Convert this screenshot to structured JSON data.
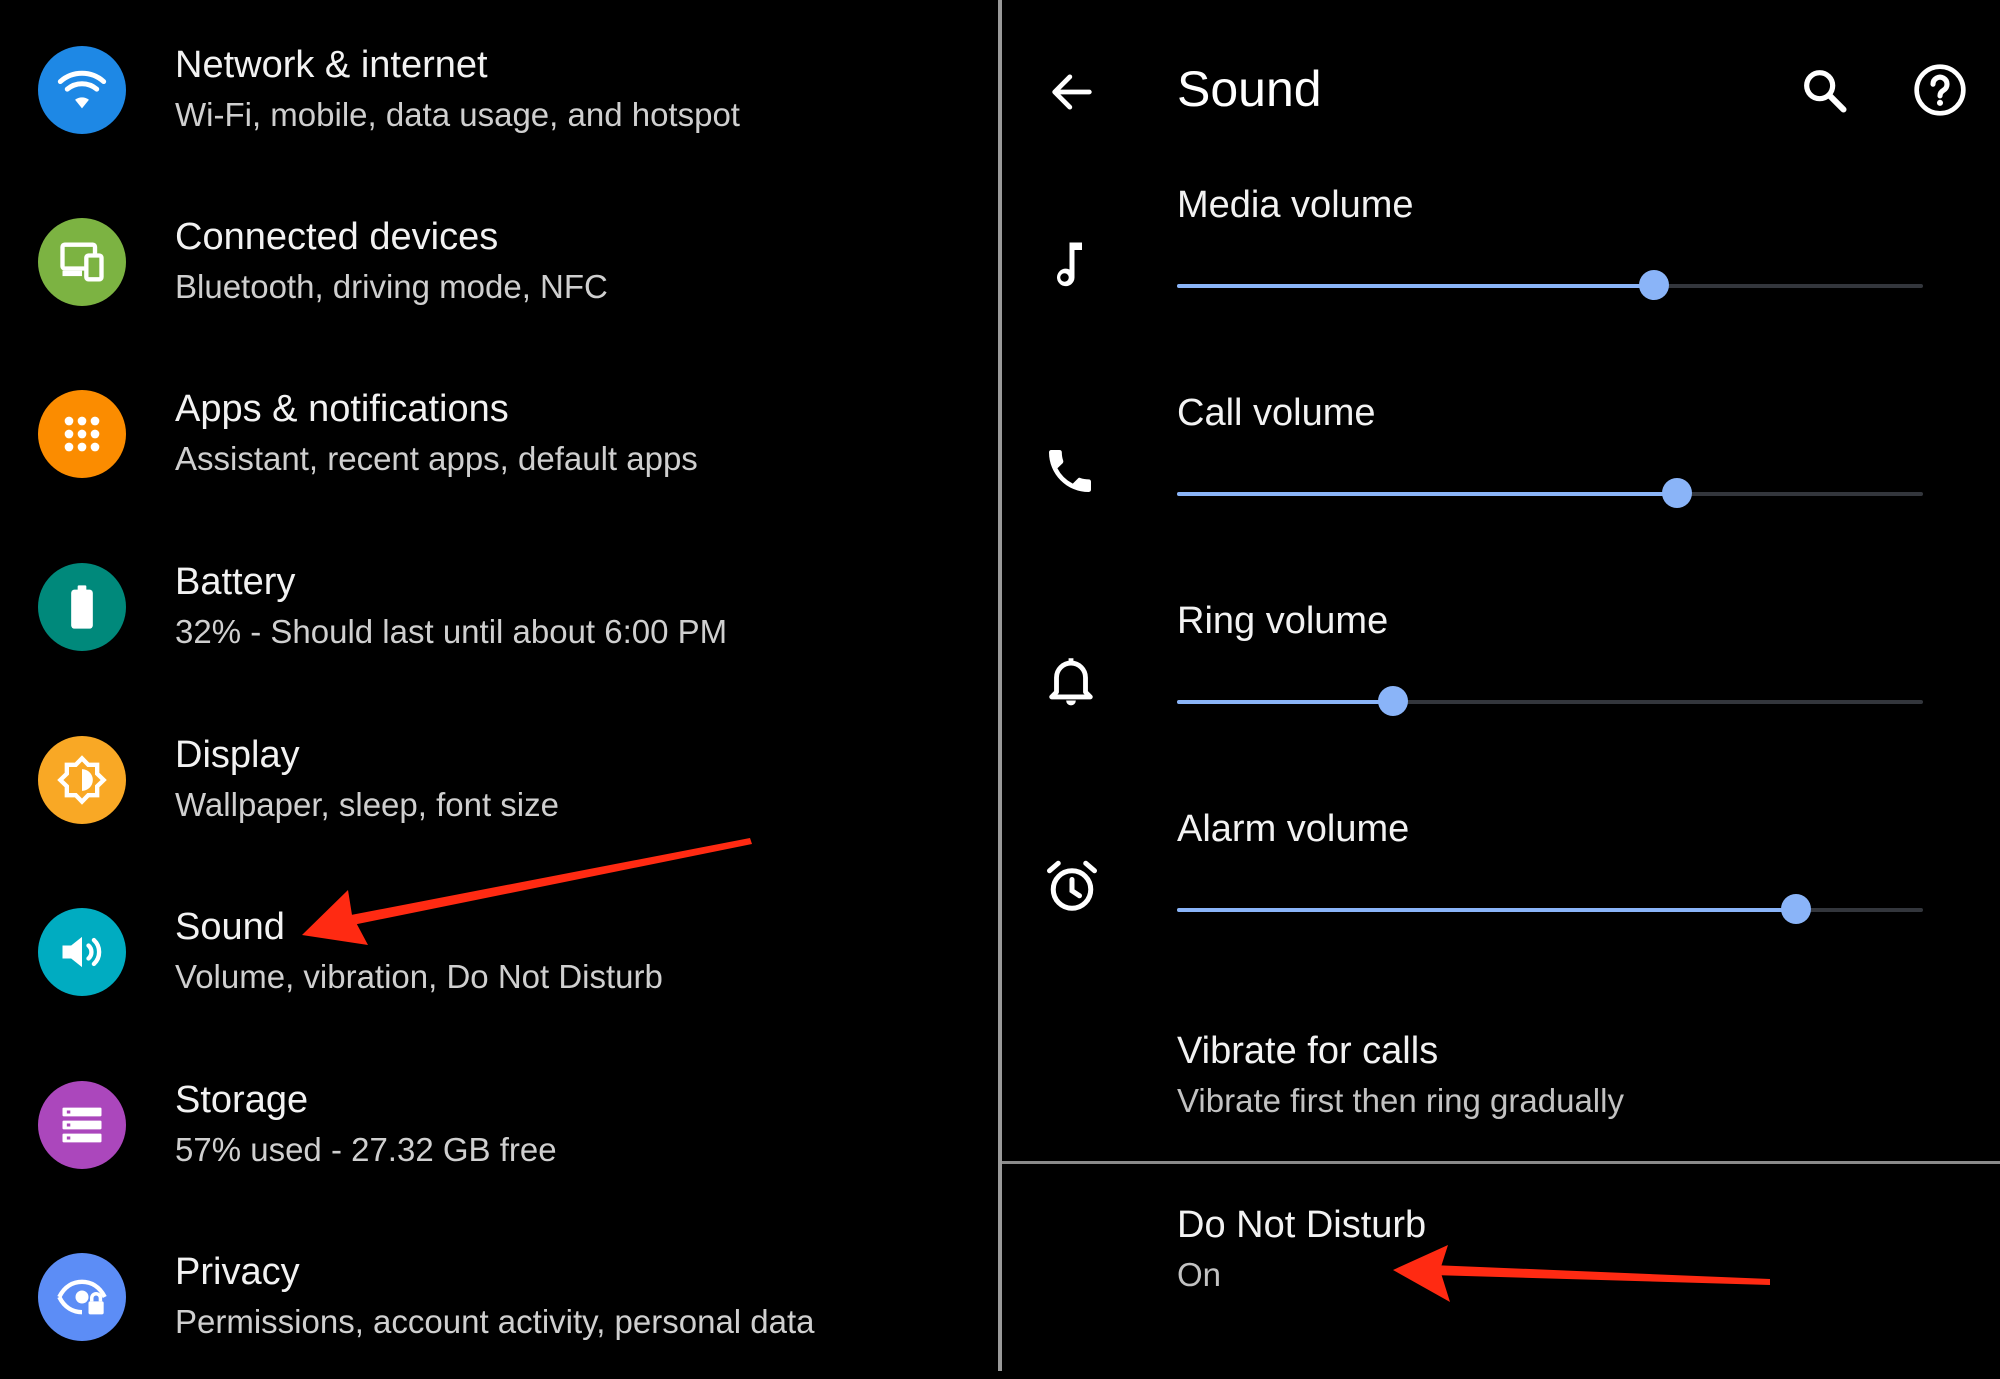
{
  "left_panel": {
    "items": [
      {
        "title": "Network & internet",
        "subtitle": "Wi-Fi, mobile, data usage, and hotspot",
        "icon": "wifi-icon",
        "color": "#1e88e5"
      },
      {
        "title": "Connected devices",
        "subtitle": "Bluetooth, driving mode, NFC",
        "icon": "devices-icon",
        "color": "#7cb342"
      },
      {
        "title": "Apps & notifications",
        "subtitle": "Assistant, recent apps, default apps",
        "icon": "apps-grid-icon",
        "color": "#fb8c00"
      },
      {
        "title": "Battery",
        "subtitle": "32% - Should last until about 6:00 PM",
        "icon": "battery-icon",
        "color": "#00897b"
      },
      {
        "title": "Display",
        "subtitle": "Wallpaper, sleep, font size",
        "icon": "brightness-icon",
        "color": "#f9a825"
      },
      {
        "title": "Sound",
        "subtitle": "Volume, vibration, Do Not Disturb",
        "icon": "volume-icon",
        "color": "#00acc1"
      },
      {
        "title": "Storage",
        "subtitle": "57% used - 27.32 GB free",
        "icon": "storage-icon",
        "color": "#ab47bc"
      },
      {
        "title": "Privacy",
        "subtitle": "Permissions, account activity, personal data",
        "icon": "privacy-eye-icon",
        "color": "#5c8df6"
      }
    ]
  },
  "right_panel": {
    "title": "Sound",
    "header_icons": [
      "back-arrow-icon",
      "search-icon",
      "help-icon"
    ],
    "volumes": [
      {
        "label": "Media volume",
        "icon": "music-note-icon",
        "level": 0.64
      },
      {
        "label": "Call volume",
        "icon": "phone-icon",
        "level": 0.67
      },
      {
        "label": "Ring volume",
        "icon": "bell-icon",
        "level": 0.29
      },
      {
        "label": "Alarm volume",
        "icon": "alarm-clock-icon",
        "level": 0.83
      }
    ],
    "vibrate": {
      "title": "Vibrate for calls",
      "subtitle": "Vibrate first then ring gradually"
    },
    "dnd": {
      "title": "Do Not Disturb",
      "subtitle": "On"
    }
  },
  "colors": {
    "accent": "#8ab4f8",
    "annotation_arrow": "#ff2a12",
    "background": "#000000"
  }
}
